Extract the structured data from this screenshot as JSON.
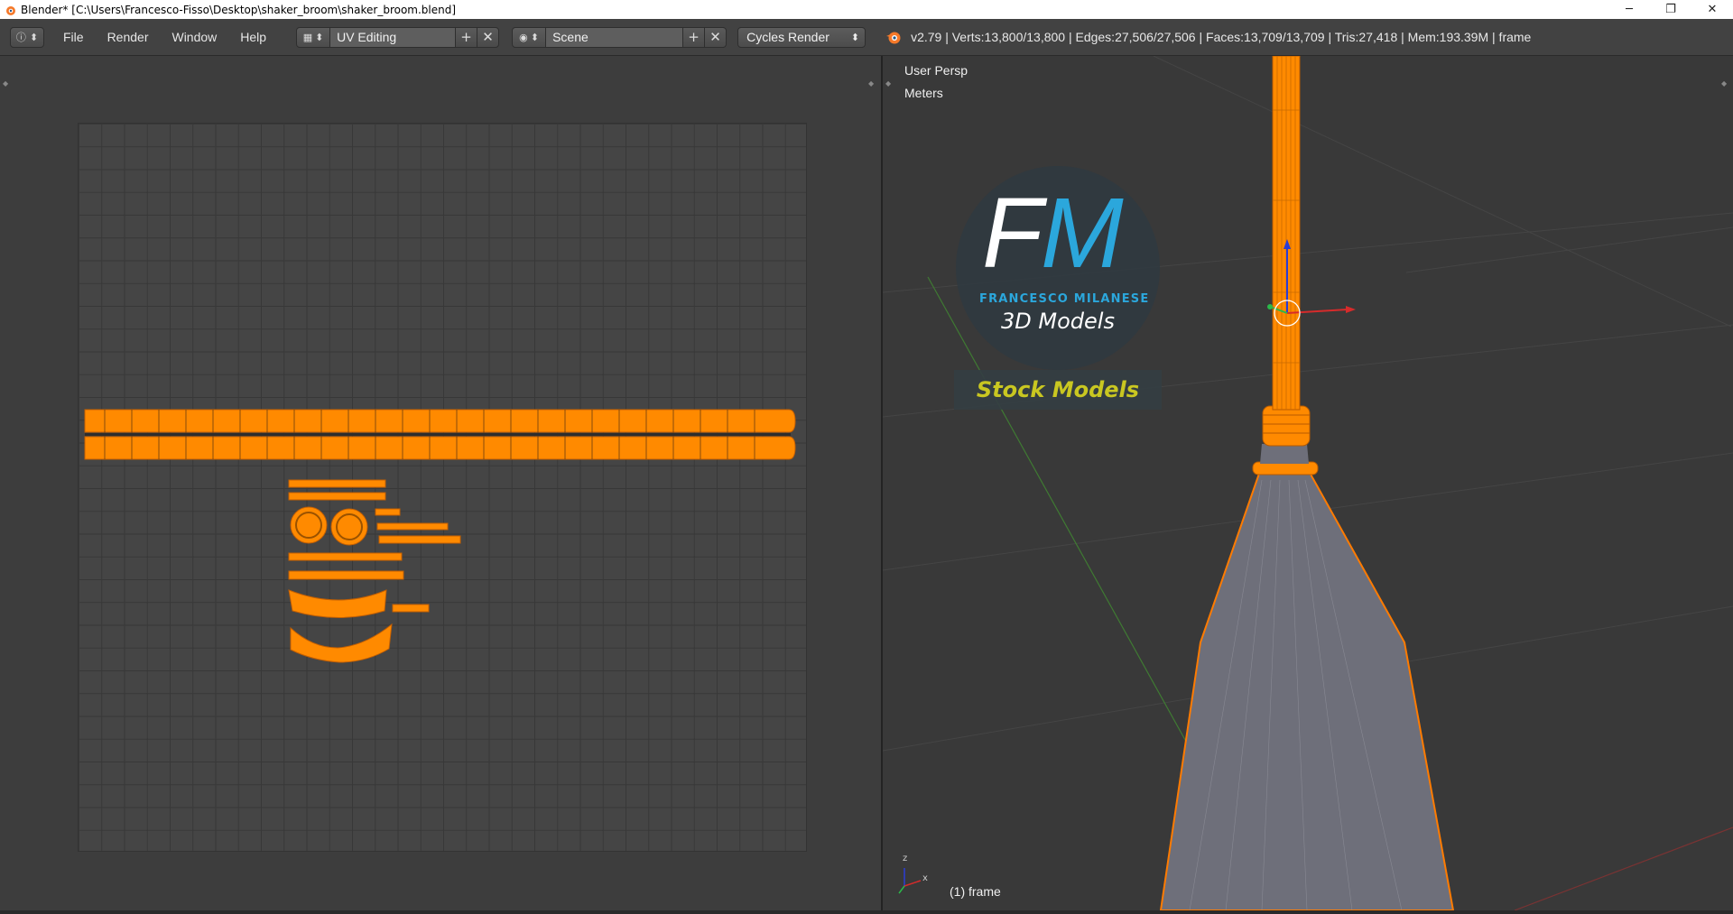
{
  "window": {
    "title": "Blender* [C:\\Users\\Francesco-Fisso\\Desktop\\shaker_broom\\shaker_broom.blend]",
    "minimize_glyph": "─",
    "maximize_glyph": "❐",
    "close_glyph": "✕"
  },
  "menu": {
    "items": [
      "File",
      "Render",
      "Window",
      "Help"
    ]
  },
  "screen_layout": {
    "value": "UV Editing",
    "add_glyph": "+",
    "remove_glyph": "✕"
  },
  "scene": {
    "value": "Scene",
    "add_glyph": "+",
    "remove_glyph": "✕"
  },
  "render_engine": {
    "value": "Cycles Render"
  },
  "stats": "v2.79 | Verts:13,800/13,800 | Edges:27,506/27,506 | Faces:13,709/13,709 | Tris:27,418 | Mem:193.39M | frame",
  "viewport": {
    "view_name": "User Persp",
    "units": "Meters",
    "object_label": "(1) frame",
    "axis_x": "x",
    "axis_z": "z"
  },
  "watermark": {
    "letter_f": "F",
    "letter_m": "M",
    "name": "FRANCESCO MILANESE",
    "subtitle": "3D Models",
    "banner": "Stock Models"
  },
  "colors": {
    "selection": "#ff8a00",
    "brand_blue": "#2ba7dc",
    "brand_yellow": "#c9c721"
  }
}
